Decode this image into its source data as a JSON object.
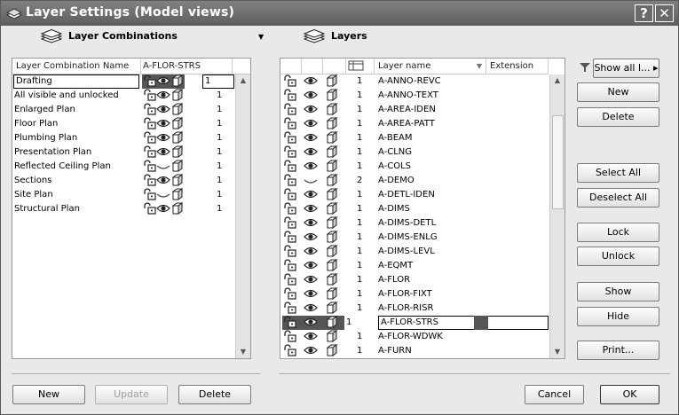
{
  "window": {
    "title": "Layer Settings (Model views)"
  },
  "left": {
    "header": "Layer Combinations",
    "col_name": "Layer Combination Name",
    "col_combo": "A-FLOR-STRS",
    "rows": [
      {
        "name": "Drafting",
        "num": "1",
        "selected": true
      },
      {
        "name": "All visible and unlocked",
        "num": "1"
      },
      {
        "name": "Enlarged Plan",
        "num": "1"
      },
      {
        "name": "Floor Plan",
        "num": "1"
      },
      {
        "name": "Plumbing Plan",
        "num": "1"
      },
      {
        "name": "Presentation Plan",
        "num": "1"
      },
      {
        "name": "Reflected Ceiling Plan",
        "num": "1",
        "hidden": true
      },
      {
        "name": "Sections",
        "num": "1"
      },
      {
        "name": "Site Plan",
        "num": "1",
        "hidden": true
      },
      {
        "name": "Structural Plan",
        "num": "1"
      }
    ],
    "buttons": {
      "new": "New",
      "update": "Update",
      "delete": "Delete"
    }
  },
  "right": {
    "header": "Layers",
    "col_layer_name": "Layer name",
    "col_extension": "Extension",
    "show_all": "Show all l...",
    "rows": [
      {
        "num": "1",
        "name": "A-ANNO-REVC"
      },
      {
        "num": "1",
        "name": "A-ANNO-TEXT"
      },
      {
        "num": "1",
        "name": "A-AREA-IDEN"
      },
      {
        "num": "1",
        "name": "A-AREA-PATT"
      },
      {
        "num": "1",
        "name": "A-BEAM"
      },
      {
        "num": "1",
        "name": "A-CLNG"
      },
      {
        "num": "1",
        "name": "A-COLS"
      },
      {
        "num": "2",
        "name": "A-DEMO",
        "hidden": true
      },
      {
        "num": "1",
        "name": "A-DETL-IDEN"
      },
      {
        "num": "1",
        "name": "A-DIMS"
      },
      {
        "num": "1",
        "name": "A-DIMS-DETL"
      },
      {
        "num": "1",
        "name": "A-DIMS-ENLG"
      },
      {
        "num": "1",
        "name": "A-DIMS-LEVL"
      },
      {
        "num": "1",
        "name": "A-EQMT"
      },
      {
        "num": "1",
        "name": "A-FLOR"
      },
      {
        "num": "1",
        "name": "A-FLOR-FIXT"
      },
      {
        "num": "1",
        "name": "A-FLOR-RISR"
      },
      {
        "num": "1",
        "name": "A-FLOR-STRS",
        "selected": true
      },
      {
        "num": "1",
        "name": "A-FLOR-WDWK"
      },
      {
        "num": "1",
        "name": "A-FURN"
      }
    ],
    "buttons": {
      "new": "New",
      "delete": "Delete",
      "select_all": "Select All",
      "deselect_all": "Deselect All",
      "lock": "Lock",
      "unlock": "Unlock",
      "show": "Show",
      "hide": "Hide",
      "print": "Print..."
    }
  },
  "footer": {
    "cancel": "Cancel",
    "ok": "OK"
  }
}
